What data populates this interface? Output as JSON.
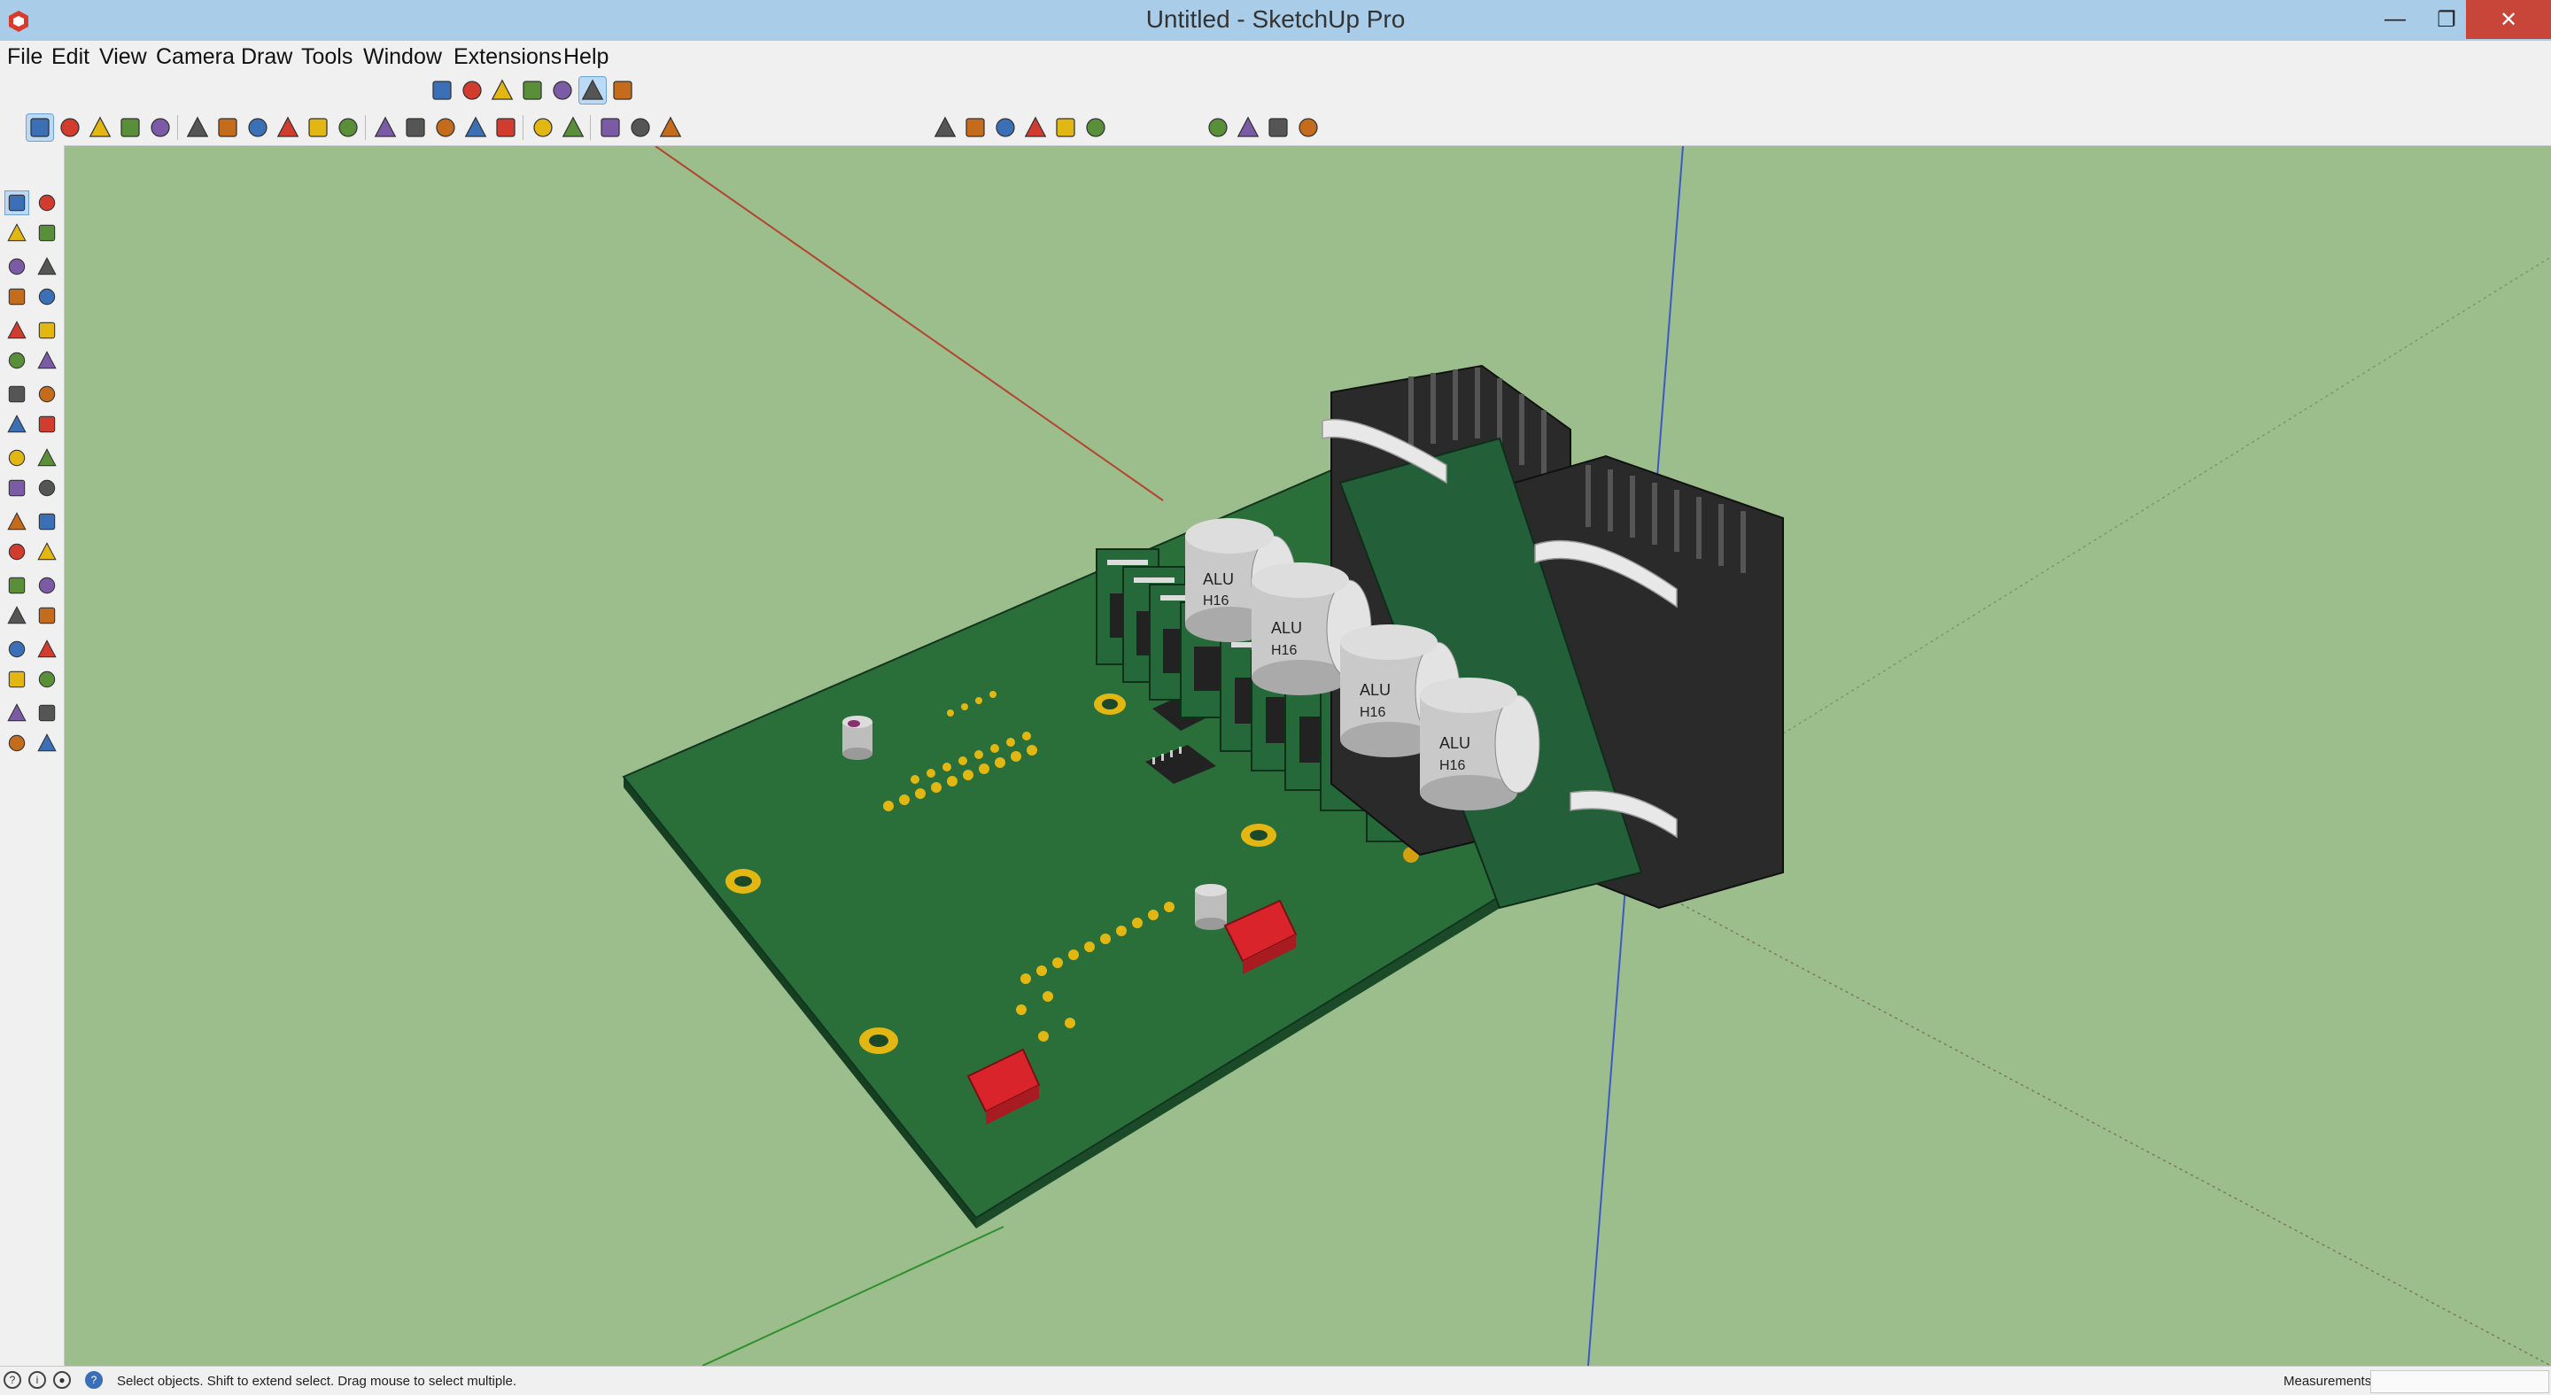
{
  "window": {
    "title": "Untitled - SketchUp Pro",
    "app_icon": "sketchup-logo-icon",
    "controls": [
      "minimize-icon",
      "restore-icon",
      "close-icon"
    ]
  },
  "menu": {
    "items": [
      "File",
      "Edit",
      "View",
      "Camera",
      "Draw",
      "Tools",
      "Window",
      "Extensions",
      "Help"
    ]
  },
  "toolbars": {
    "styles": [
      "xray-style-icon",
      "back-edges-style-icon",
      "wireframe-style-icon",
      "hidden-line-style-icon",
      "shaded-style-icon",
      "shaded-with-textures-style-icon",
      "monochrome-style-icon"
    ],
    "getting_started": [
      "select-icon",
      "eraser-icon",
      "line-icon",
      "arc-icon",
      "circle-icon",
      "push-pull-icon",
      "offset-icon",
      "move-icon",
      "rotate-icon",
      "scale-icon",
      "tape-measure-icon",
      "text-icon",
      "paint-bucket-icon",
      "orbit-icon",
      "pan-icon",
      "zoom-icon",
      "zoom-extents-icon",
      "warehouse-icon",
      "extension-warehouse-icon",
      "layout-icon",
      "ruby-console-icon"
    ],
    "views": [
      "iso-view-icon",
      "top-view-icon",
      "front-view-icon",
      "right-view-icon",
      "back-view-icon",
      "left-view-icon"
    ],
    "extras": [
      "section-plane-icon",
      "section-display-icon",
      "extension-a-icon",
      "extension-b-icon"
    ],
    "selected_style_index": 5,
    "selected_tool_index": 0
  },
  "left_toolbar": {
    "tools": [
      "select-icon",
      "make-component-icon",
      "paint-bucket-icon",
      "eraser-icon",
      "line-icon",
      "freehand-icon",
      "rectangle-icon",
      "rotated-rectangle-icon",
      "circle-icon",
      "polygon-icon",
      "arc-icon",
      "two-point-arc-icon",
      "three-point-arc-icon",
      "pie-icon",
      "move-icon",
      "push-pull-icon",
      "rotate-icon",
      "follow-me-icon",
      "scale-icon",
      "offset-icon",
      "tape-measure-icon",
      "dimension-icon",
      "protractor-icon",
      "text-icon",
      "axes-icon",
      "3d-text-icon",
      "orbit-icon",
      "pan-icon",
      "zoom-icon",
      "zoom-window-icon",
      "zoom-extents-icon",
      "previous-view-icon",
      "position-camera-icon",
      "look-around-icon",
      "walk-icon",
      "section-plane-icon"
    ]
  },
  "model": {
    "capacitor_marking_line1": "ALU",
    "capacitor_marking_line2": "H16"
  },
  "status": {
    "icons": [
      "geo-location-icon",
      "credits-icon",
      "user-icon",
      "help-icon"
    ],
    "message": "Select objects. Shift to extend select. Drag mouse to select multiple.",
    "measurements_label": "Measurements",
    "measurements_value": ""
  },
  "colors": {
    "titlebar": "#a9cde9",
    "chrome": "#f0f0f0",
    "viewport_ground": "#9bbe8c",
    "pcb": "#2a6e3a",
    "pcb_dark": "#1f5a2d",
    "heatsink": "#2a2a2a",
    "capacitor": "#c9c9c9",
    "connector_red": "#d9242b",
    "pad_gold": "#e2b711"
  }
}
